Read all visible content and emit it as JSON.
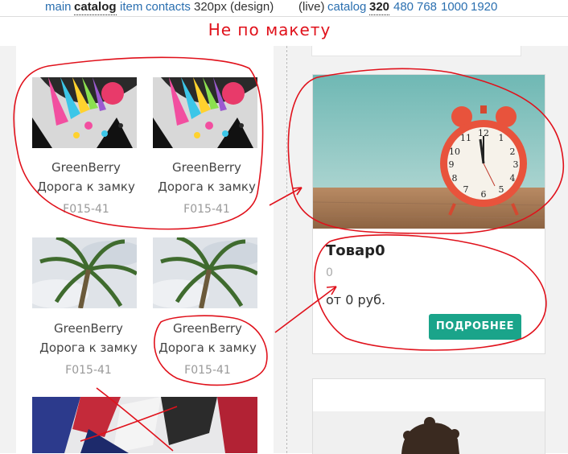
{
  "topnav": {
    "main": "main",
    "catalog": "catalog",
    "item": "item",
    "contacts": "contacts",
    "design_label": "320px (design)",
    "live_label": "(live)",
    "live_catalog": "catalog",
    "w320": "320",
    "w480": "480",
    "w768": "768",
    "w1000": "1000",
    "w1920": "1920"
  },
  "banner": {
    "text": "Не по макету"
  },
  "products_left": [
    {
      "brand": "GreenBerry",
      "title": "Дорога к замку",
      "sku": "F015-41"
    },
    {
      "brand": "GreenBerry",
      "title": "Дорога к замку",
      "sku": "F015-41"
    },
    {
      "brand": "GreenBerry",
      "title": "Дорога к замку",
      "sku": "F015-41"
    },
    {
      "brand": "GreenBerry",
      "title": "Дорога к замку",
      "sku": "F015-41"
    }
  ],
  "product_right": {
    "title": "Товар0",
    "count": "0",
    "price": "от 0 руб.",
    "button": "ПОДРОБНЕЕ"
  },
  "colors": {
    "annotation": "#e0111b",
    "button": "#1aa48a",
    "link": "#2a6fb0"
  },
  "icons": {
    "thumb1": "colorful-graffiti-image",
    "thumb2": "palm-tree-image",
    "thumb3": "torn-poster-image",
    "hero": "alarm-clock-image"
  }
}
